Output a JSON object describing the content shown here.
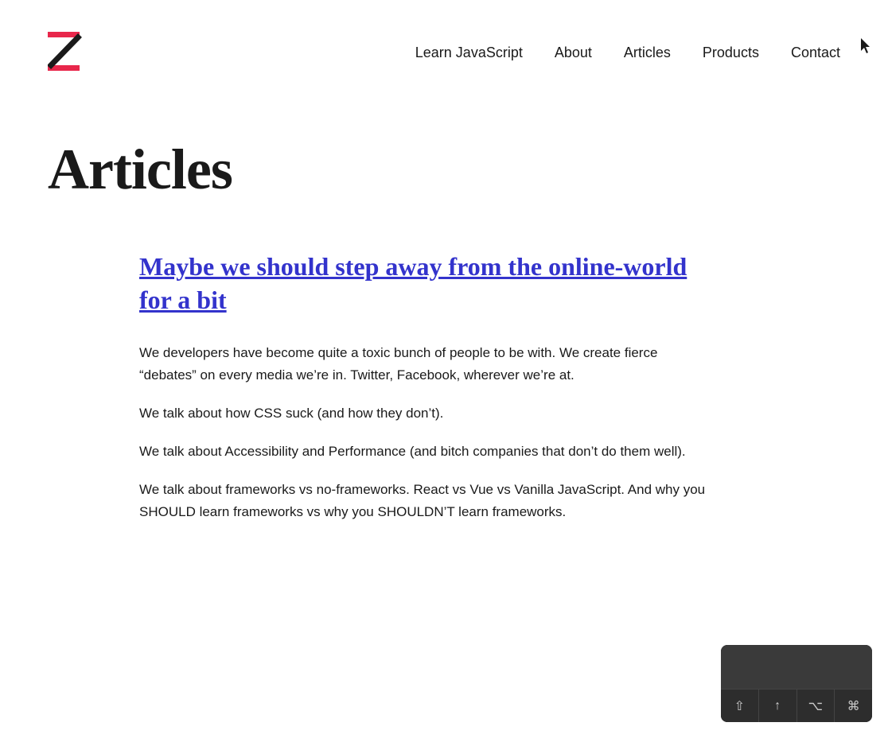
{
  "logo": {
    "alt": "Z logo"
  },
  "nav": {
    "items": [
      {
        "label": "Learn JavaScript",
        "href": "#"
      },
      {
        "label": "About",
        "href": "#"
      },
      {
        "label": "Articles",
        "href": "#"
      },
      {
        "label": "Products",
        "href": "#"
      },
      {
        "label": "Contact",
        "href": "#"
      }
    ]
  },
  "page": {
    "title": "Articles"
  },
  "article": {
    "title": "Maybe we should step away from the online-world for a bit",
    "paragraphs": [
      "We developers have become quite a toxic bunch of people to be with. We create fierce “debates” on every media we’re in. Twitter, Facebook, wherever we’re at.",
      "We talk about how CSS suck (and how they don’t).",
      "We talk about Accessibility and Performance (and bitch companies that don’t do them well).",
      "We talk about frameworks vs no-frameworks. React vs Vue vs Vanilla JavaScript. And why you SHOULD learn frameworks vs why you SHOULDN’T learn frameworks."
    ]
  },
  "toolbar": {
    "buttons": [
      {
        "label": "⇧",
        "name": "shift-key"
      },
      {
        "label": "↑",
        "name": "up-arrow-key"
      },
      {
        "label": "⌥",
        "name": "option-key"
      },
      {
        "label": "⌘",
        "name": "command-key"
      }
    ]
  }
}
